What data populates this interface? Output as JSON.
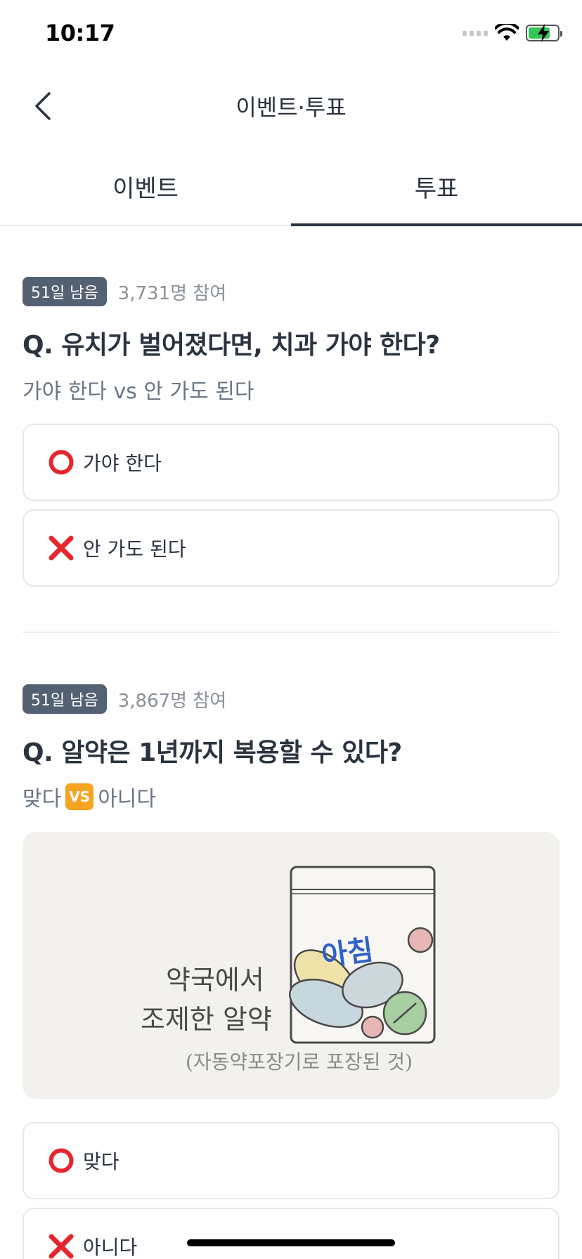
{
  "status_bar": {
    "time": "10:17"
  },
  "nav": {
    "title": "이벤트·투표",
    "back_icon": "chevron-left-icon"
  },
  "tabs": [
    {
      "label": "이벤트",
      "active": false
    },
    {
      "label": "투표",
      "active": true
    }
  ],
  "polls": [
    {
      "days_left": "51일 남음",
      "participants": "3,731명 참여",
      "question": "Q. 유치가 벌어졌다면, 치과 가야 한다?",
      "subtitle": "가야 한다 vs 안 가도 된다",
      "options": [
        {
          "icon": "red-circle-icon",
          "label": "가야 한다"
        },
        {
          "icon": "red-x-icon",
          "label": "안 가도 된다"
        }
      ]
    },
    {
      "days_left": "51일 남음",
      "participants": "3,867명 참여",
      "question": "Q. 알약은 1년까지 복용할 수 있다?",
      "subtitle_left": "맞다",
      "vs": "VS",
      "subtitle_right": "아니다",
      "illustration": {
        "line1": "약국에서",
        "line2": "조제한 알약",
        "note": "(자동약포장기로 포장된 것)",
        "bag_label": "아침"
      },
      "options": [
        {
          "icon": "red-circle-icon",
          "label": "맞다"
        },
        {
          "icon": "red-x-icon",
          "label": "아니다"
        }
      ]
    }
  ],
  "colors": {
    "primary_text": "#2b3340",
    "badge_bg": "#546173",
    "vs_badge": "#f6a320",
    "mark_red": "#e5262f"
  }
}
